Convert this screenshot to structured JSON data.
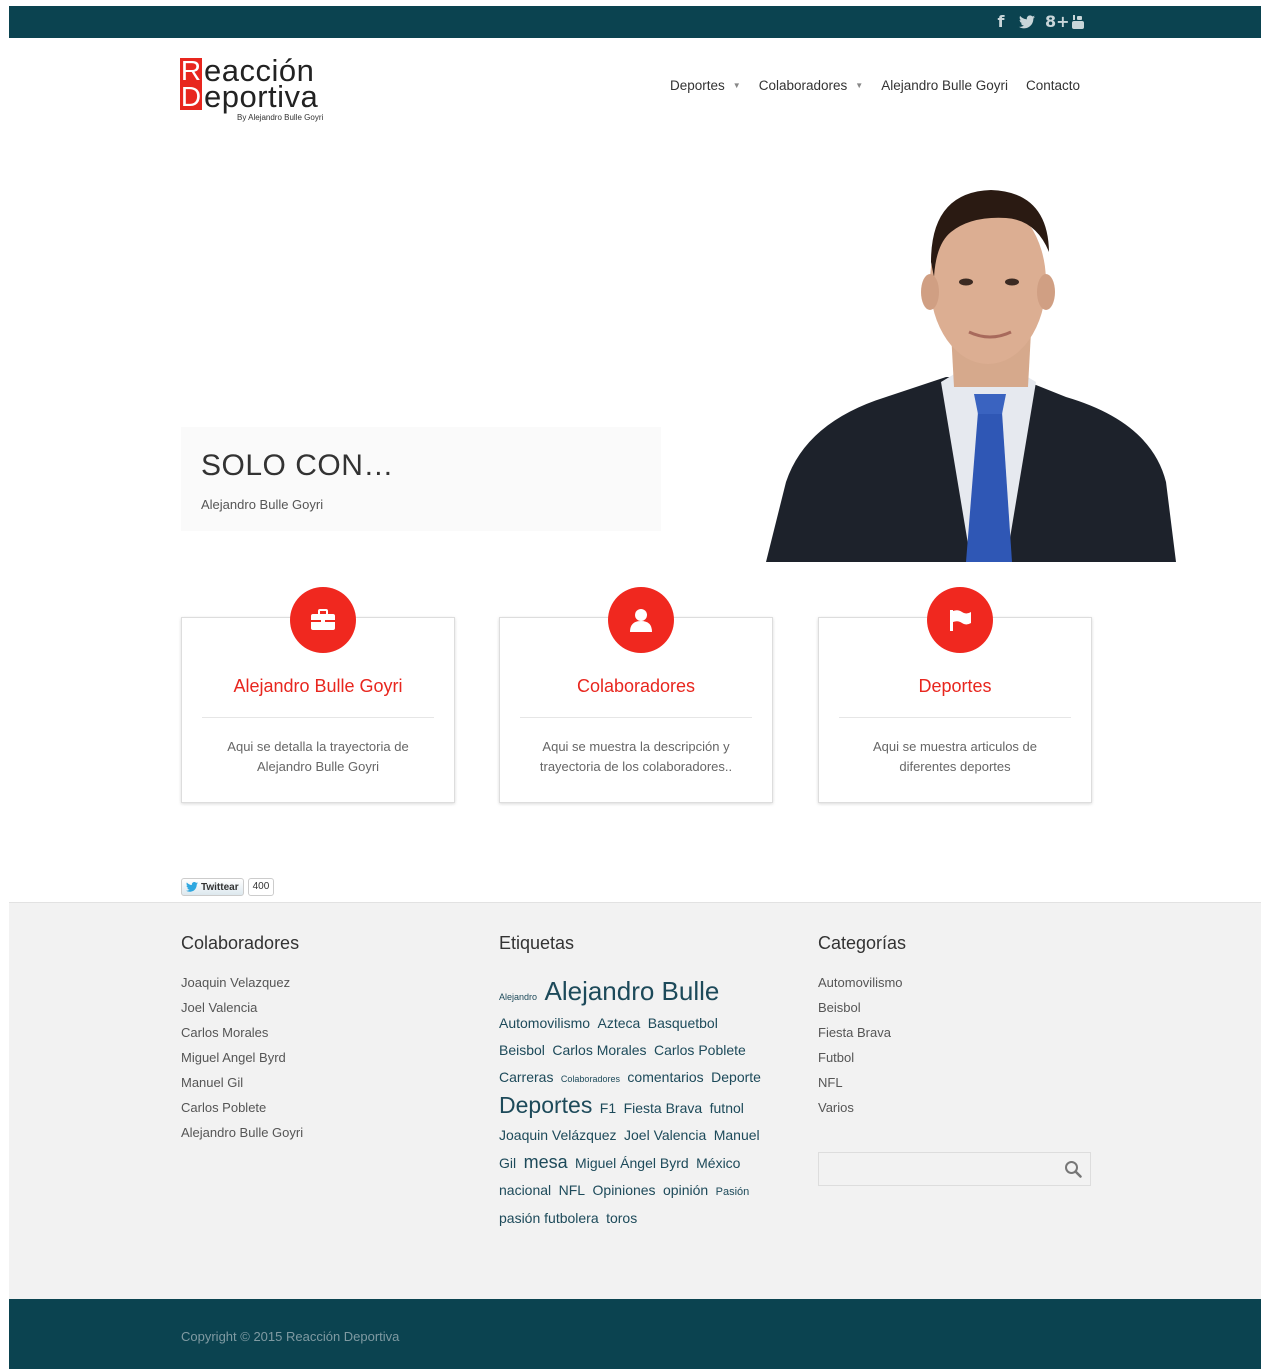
{
  "social": {
    "facebook": "f",
    "twitter_icon": "twitter-icon",
    "googleplus": "8+",
    "youtube_icon": "youtube-icon"
  },
  "logo": {
    "letter1": "R",
    "rest1": "eacción",
    "letter2": "D",
    "rest2": "eportiva",
    "byline": "By Alejandro Bulle Goyri"
  },
  "nav": {
    "items": [
      {
        "label": "Deportes",
        "dropdown": true
      },
      {
        "label": "Colaboradores",
        "dropdown": true
      },
      {
        "label": "Alejandro Bulle Goyri",
        "dropdown": false
      },
      {
        "label": "Contacto",
        "dropdown": false
      }
    ]
  },
  "hero": {
    "title": "SOLO CON…",
    "subtitle": "Alejandro Bulle Goyri"
  },
  "cards": [
    {
      "icon": "briefcase-icon",
      "title": "Alejandro Bulle Goyri",
      "desc": "Aqui se detalla la trayectoria de Alejandro Bulle Goyri"
    },
    {
      "icon": "user-icon",
      "title": "Colaboradores",
      "desc": "Aqui se muestra la descripción y trayectoria de los colaboradores.."
    },
    {
      "icon": "flag-icon",
      "title": "Deportes",
      "desc": "Aqui se muestra articulos de diferentes deportes"
    }
  ],
  "tweet": {
    "label": "Twittear",
    "count": "400"
  },
  "footer": {
    "col1_title": "Colaboradores",
    "colaboradores": [
      "Joaquin Velazquez",
      "Joel Valencia",
      "Carlos Morales",
      "Miguel Angel Byrd",
      "Manuel Gil",
      "Carlos Poblete",
      "Alejandro Bulle Goyri"
    ],
    "col2_title": "Etiquetas",
    "tags": [
      {
        "t": "Alejandro",
        "s": 9
      },
      {
        "t": "Alejandro Bulle",
        "s": 26
      },
      {
        "t": "Automovilismo",
        "s": 14
      },
      {
        "t": "Azteca",
        "s": 14
      },
      {
        "t": "Basquetbol",
        "s": 14
      },
      {
        "t": "Beisbol",
        "s": 14
      },
      {
        "t": "Carlos Morales",
        "s": 14
      },
      {
        "t": "Carlos Poblete",
        "s": 14
      },
      {
        "t": "Carreras",
        "s": 14
      },
      {
        "t": "Colaboradores",
        "s": 9
      },
      {
        "t": "comentarios",
        "s": 14
      },
      {
        "t": "Deporte",
        "s": 14
      },
      {
        "t": "Deportes",
        "s": 23
      },
      {
        "t": "F1",
        "s": 14
      },
      {
        "t": "Fiesta Brava",
        "s": 14
      },
      {
        "t": "futnol",
        "s": 14
      },
      {
        "t": "Joaquin Velázquez",
        "s": 14
      },
      {
        "t": "Joel Valencia",
        "s": 14
      },
      {
        "t": "Manuel Gil",
        "s": 14
      },
      {
        "t": "mesa",
        "s": 18
      },
      {
        "t": "Miguel Ángel Byrd",
        "s": 14
      },
      {
        "t": "México",
        "s": 14
      },
      {
        "t": "nacional",
        "s": 14
      },
      {
        "t": "NFL",
        "s": 14
      },
      {
        "t": "Opiniones",
        "s": 14
      },
      {
        "t": "opinión",
        "s": 14
      },
      {
        "t": "Pasión",
        "s": 11
      },
      {
        "t": "pasión futbolera",
        "s": 14
      },
      {
        "t": "toros",
        "s": 14
      }
    ],
    "col3_title": "Categorías",
    "categorias": [
      "Automovilismo",
      "Beisbol",
      "Fiesta Brava",
      "Futbol",
      "NFL",
      "Varios"
    ],
    "search_placeholder": ""
  },
  "copyright": "Copyright © 2015 Reacción Deportiva"
}
